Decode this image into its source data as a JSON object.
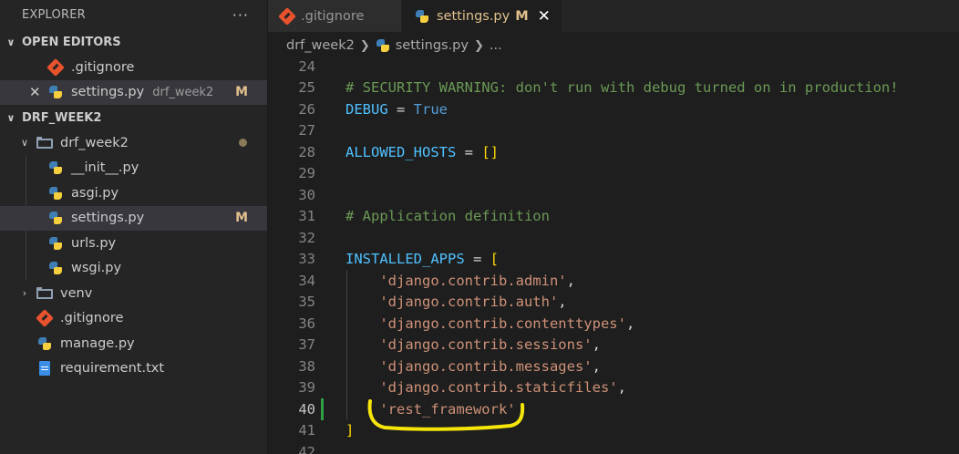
{
  "sidebar": {
    "title": "EXPLORER",
    "more": "···",
    "open_editors": {
      "title": "OPEN EDITORS",
      "items": [
        {
          "label": ".gitignore",
          "icon": "git-icon"
        },
        {
          "label": "settings.py",
          "description": "drf_week2",
          "badge": "M",
          "icon": "python-icon"
        }
      ]
    },
    "workspace": {
      "title": "DRF_WEEK2",
      "tree": [
        {
          "label": "drf_week2",
          "type": "folder-open"
        },
        {
          "label": "__init__.py",
          "type": "python"
        },
        {
          "label": "asgi.py",
          "type": "python"
        },
        {
          "label": "settings.py",
          "type": "python",
          "badge": "M"
        },
        {
          "label": "urls.py",
          "type": "python"
        },
        {
          "label": "wsgi.py",
          "type": "python"
        },
        {
          "label": "venv",
          "type": "folder-closed"
        },
        {
          "label": ".gitignore",
          "type": "git"
        },
        {
          "label": "manage.py",
          "type": "python"
        },
        {
          "label": "requirement.txt",
          "type": "text"
        }
      ]
    }
  },
  "tabs": [
    {
      "label": ".gitignore",
      "icon": "git-icon",
      "active": false
    },
    {
      "label": "settings.py",
      "icon": "python-icon",
      "active": true,
      "badge": "M",
      "close": "✕"
    }
  ],
  "breadcrumb": {
    "folder": "drf_week2",
    "file": "settings.py",
    "tail": "..."
  },
  "editor": {
    "lines": [
      {
        "num": "24",
        "tokens": []
      },
      {
        "num": "25",
        "tokens": [
          {
            "t": "# SECURITY WARNING: don't run with debug turned on in production!",
            "c": "comment"
          }
        ]
      },
      {
        "num": "26",
        "tokens": [
          {
            "t": "DEBUG",
            "c": "var"
          },
          {
            "t": " = ",
            "c": "op"
          },
          {
            "t": "True",
            "c": "kw"
          }
        ]
      },
      {
        "num": "27",
        "tokens": []
      },
      {
        "num": "28",
        "tokens": [
          {
            "t": "ALLOWED_HOSTS",
            "c": "var"
          },
          {
            "t": " = ",
            "c": "op"
          },
          {
            "t": "[]",
            "c": "brk"
          }
        ]
      },
      {
        "num": "29",
        "tokens": []
      },
      {
        "num": "30",
        "tokens": []
      },
      {
        "num": "31",
        "tokens": [
          {
            "t": "# Application definition",
            "c": "comment"
          }
        ]
      },
      {
        "num": "32",
        "tokens": []
      },
      {
        "num": "33",
        "tokens": [
          {
            "t": "INSTALLED_APPS",
            "c": "var"
          },
          {
            "t": " = ",
            "c": "op"
          },
          {
            "t": "[",
            "c": "brk"
          }
        ]
      },
      {
        "num": "34",
        "tokens": [
          {
            "t": "    ",
            "c": "op"
          },
          {
            "t": "'django.contrib.admin'",
            "c": "str"
          },
          {
            "t": ",",
            "c": "op"
          }
        ]
      },
      {
        "num": "35",
        "tokens": [
          {
            "t": "    ",
            "c": "op"
          },
          {
            "t": "'django.contrib.auth'",
            "c": "str"
          },
          {
            "t": ",",
            "c": "op"
          }
        ]
      },
      {
        "num": "36",
        "tokens": [
          {
            "t": "    ",
            "c": "op"
          },
          {
            "t": "'django.contrib.contenttypes'",
            "c": "str"
          },
          {
            "t": ",",
            "c": "op"
          }
        ]
      },
      {
        "num": "37",
        "tokens": [
          {
            "t": "    ",
            "c": "op"
          },
          {
            "t": "'django.contrib.sessions'",
            "c": "str"
          },
          {
            "t": ",",
            "c": "op"
          }
        ]
      },
      {
        "num": "38",
        "tokens": [
          {
            "t": "    ",
            "c": "op"
          },
          {
            "t": "'django.contrib.messages'",
            "c": "str"
          },
          {
            "t": ",",
            "c": "op"
          }
        ]
      },
      {
        "num": "39",
        "tokens": [
          {
            "t": "    ",
            "c": "op"
          },
          {
            "t": "'django.contrib.staticfiles'",
            "c": "str"
          },
          {
            "t": ",",
            "c": "op"
          }
        ]
      },
      {
        "num": "40",
        "tokens": [
          {
            "t": "    ",
            "c": "op"
          },
          {
            "t": "'rest_framework'",
            "c": "str"
          }
        ],
        "current": true,
        "modified": true
      },
      {
        "num": "41",
        "tokens": [
          {
            "t": "]",
            "c": "brk"
          }
        ]
      },
      {
        "num": "42",
        "tokens": []
      }
    ]
  },
  "annotation": {
    "color": "#f5e50a"
  }
}
